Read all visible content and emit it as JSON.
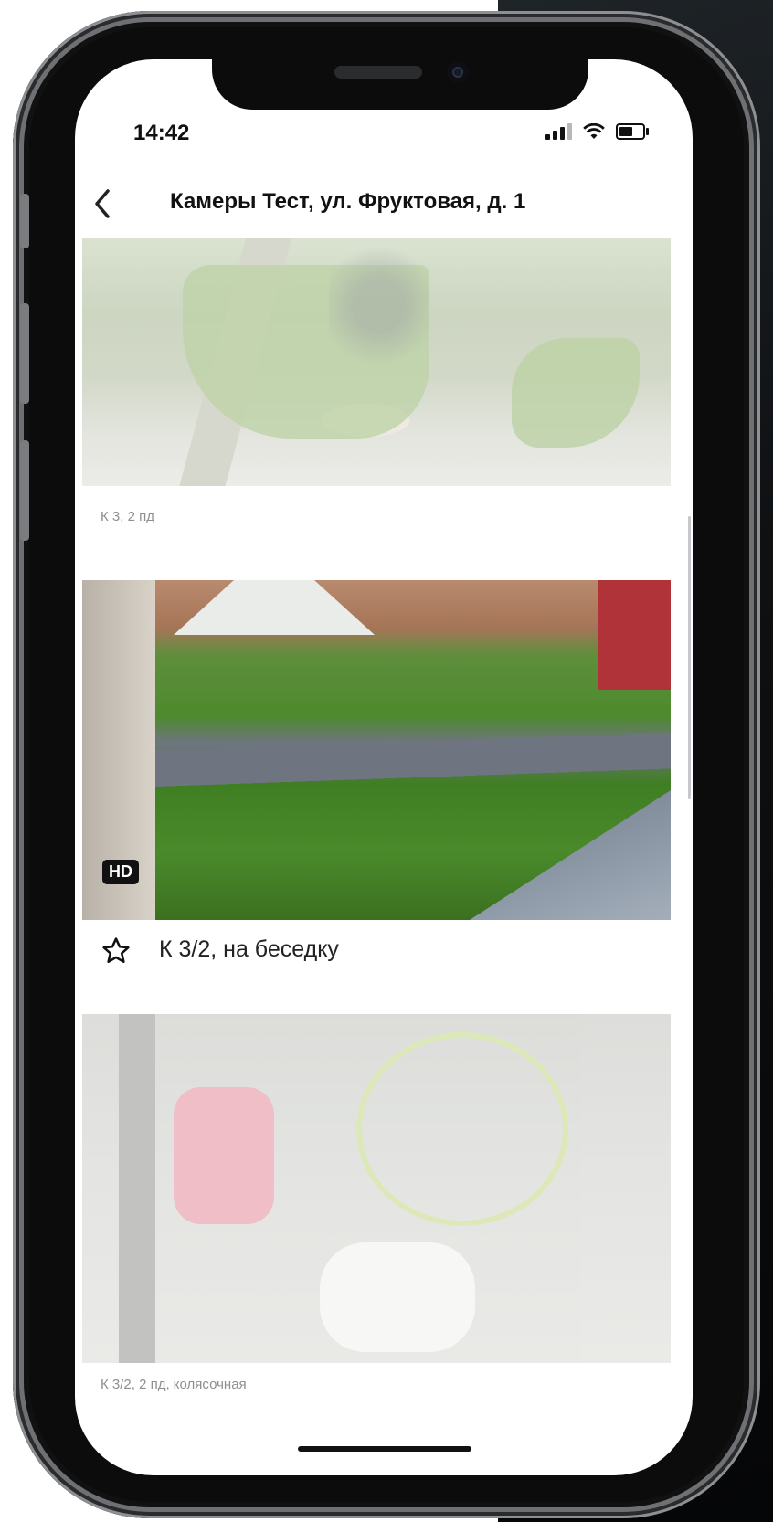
{
  "status_bar": {
    "time": "14:42"
  },
  "header": {
    "title": "Камеры Тест, ул. Фруктовая, д. 1"
  },
  "cameras": [
    {
      "label": "К 3, 2 пд"
    },
    {
      "label": "К 3/2, на беседку",
      "badge": "HD"
    },
    {
      "label": "К 3/2, 2 пд, колясочная"
    }
  ],
  "icons": {
    "back": "chevron-left-icon",
    "favorite": "star-outline-icon"
  },
  "colors": {
    "screen_bg": "#ffffff",
    "text_primary": "#111111",
    "text_secondary": "#8e8e93"
  }
}
